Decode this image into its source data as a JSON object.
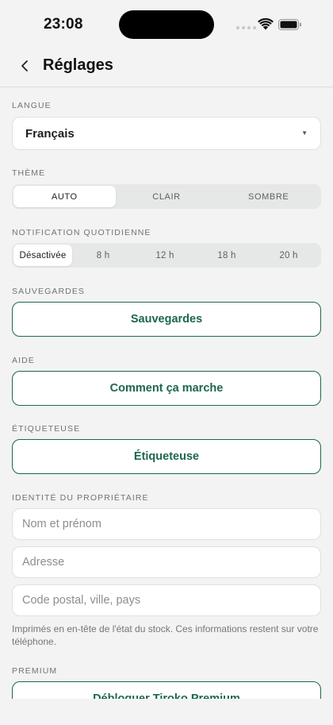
{
  "status_bar": {
    "time": "23:08"
  },
  "header": {
    "title": "Réglages"
  },
  "language": {
    "label": "LANGUE",
    "value": "Français"
  },
  "theme": {
    "label": "THÈME",
    "options": [
      "AUTO",
      "CLAIR",
      "SOMBRE"
    ],
    "selected": "AUTO"
  },
  "notification": {
    "label": "NOTIFICATION QUOTIDIENNE",
    "options": [
      "Désactivée",
      "8 h",
      "12 h",
      "18 h",
      "20 h"
    ],
    "selected": "Désactivée"
  },
  "backups": {
    "label": "SAUVEGARDES",
    "button": "Sauvegardes"
  },
  "help": {
    "label": "AIDE",
    "button": "Comment ça marche"
  },
  "labeler": {
    "label": "ÉTIQUETEUSE",
    "button": "Étiqueteuse"
  },
  "owner": {
    "label": "IDENTITÉ DU PROPRIÉTAIRE",
    "name_placeholder": "Nom et prénom",
    "address_placeholder": "Adresse",
    "city_placeholder": "Code postal, ville, pays",
    "note": "Imprimés en en-tête de l'état du stock. Ces informations restent sur votre téléphone."
  },
  "premium": {
    "label": "PREMIUM",
    "button": "Débloquer Tiroko Premium"
  },
  "colors": {
    "accent": "#1e6650",
    "background": "#f2f3f2"
  }
}
